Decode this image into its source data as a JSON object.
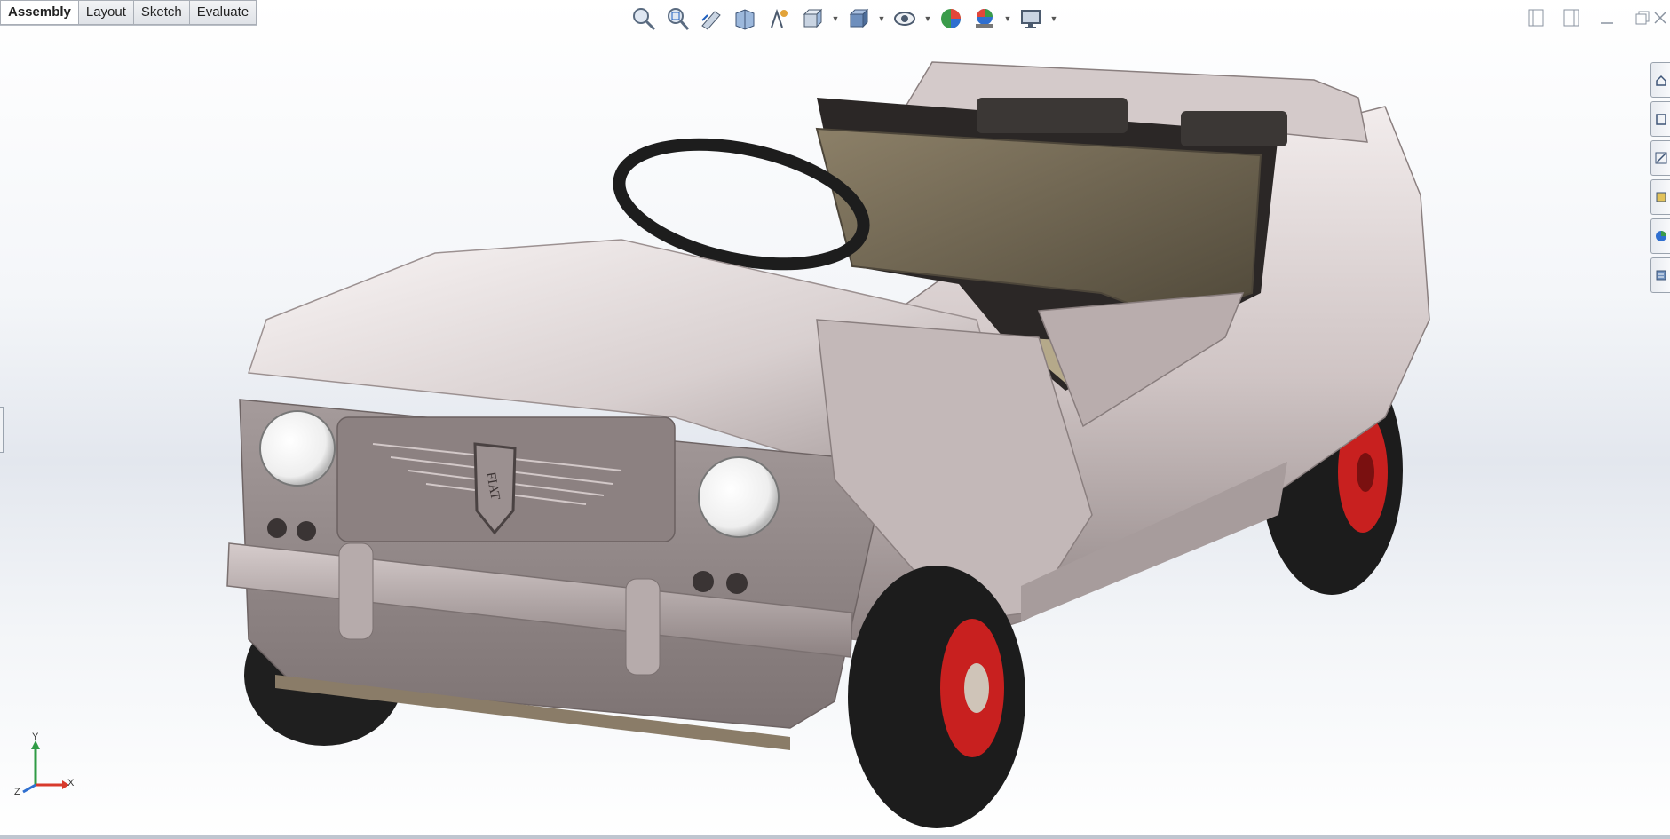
{
  "command_manager": {
    "tabs": [
      {
        "label": "Assembly",
        "active": true
      },
      {
        "label": "Layout",
        "active": false
      },
      {
        "label": "Sketch",
        "active": false
      },
      {
        "label": "Evaluate",
        "active": false
      }
    ]
  },
  "heads_up_toolbar": {
    "icons": [
      "zoom-to-fit-icon",
      "zoom-to-area-icon",
      "previous-view-icon",
      "section-view-icon",
      "dynamic-annotation-icon",
      "view-orientation-icon",
      "display-style-icon",
      "hide-show-items-icon",
      "edit-appearance-icon",
      "apply-scene-icon",
      "view-settings-icon"
    ]
  },
  "viewport": {
    "model": "toy-car-assembly",
    "grille_badge_text": "FIAT",
    "triad": {
      "x_label": "X",
      "y_label": "Y",
      "z_label": "Z"
    }
  },
  "colors": {
    "body": "#cfc4c4",
    "wheel_hub": "#c8201f",
    "tire": "#1c1c1c",
    "seat": "#b5a98a",
    "accent_blue": "#1f5fbf"
  }
}
